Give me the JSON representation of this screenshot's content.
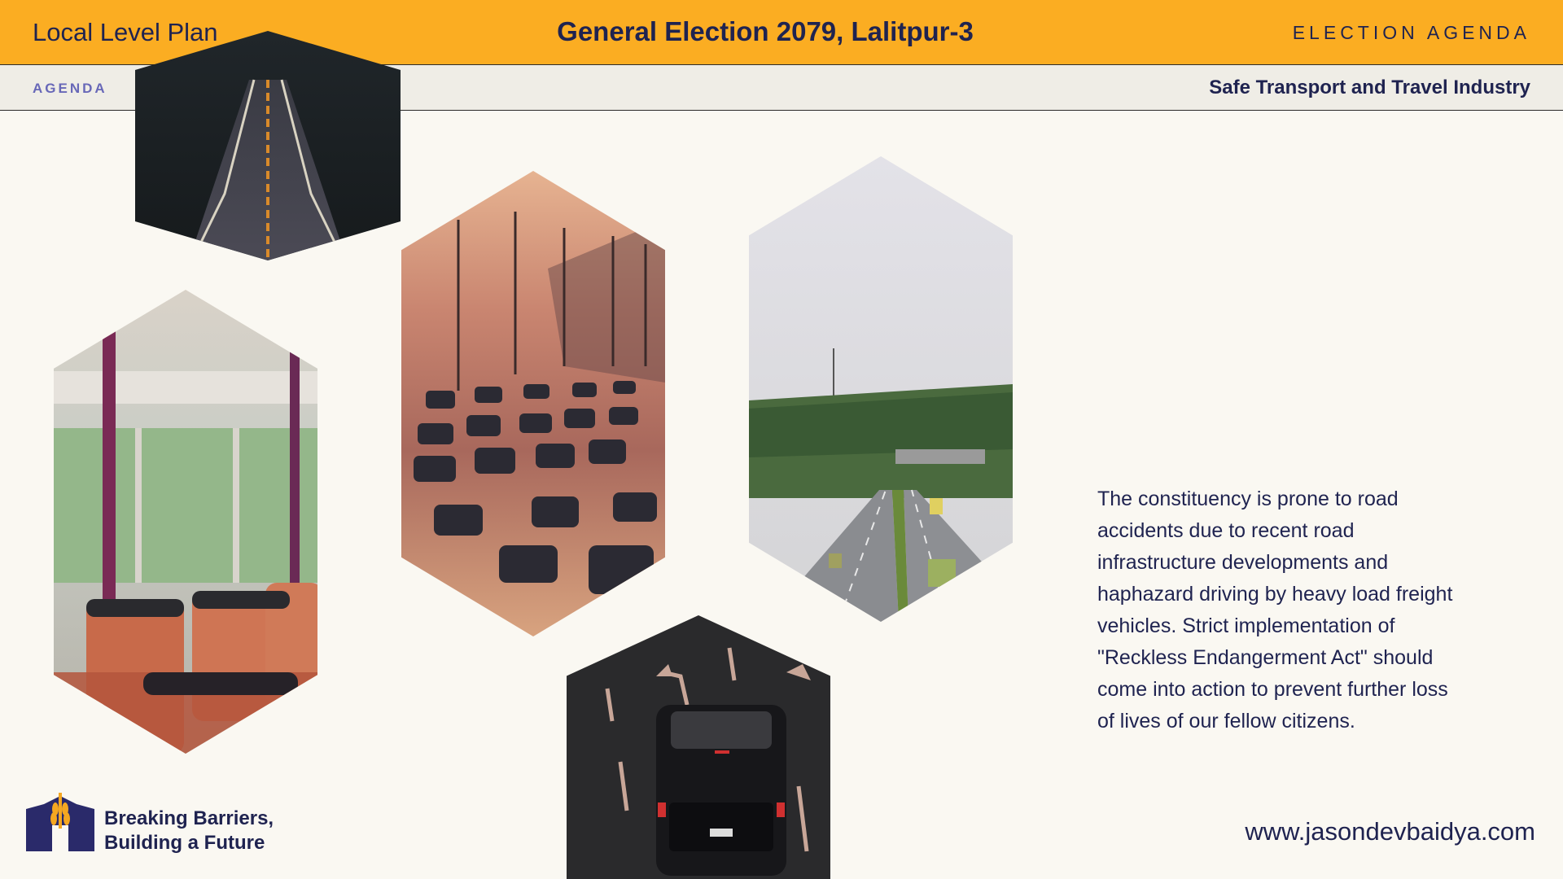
{
  "header": {
    "left_title": "Local Level Plan",
    "center_title": "General Election 2079, Lalitpur-3",
    "right_label": "ELECTION AGENDA"
  },
  "subheader": {
    "section_label": "AGENDA",
    "topic": "Safe Transport and Travel Industry"
  },
  "images": [
    {
      "name": "road-hex-image",
      "subject": "empty two-lane road at dusk"
    },
    {
      "name": "bus-interior-hex-image",
      "subject": "orange bus seats inside a bus"
    },
    {
      "name": "traffic-hex-image",
      "subject": "highway traffic at sunset"
    },
    {
      "name": "highway-hex-image",
      "subject": "divided highway with trucks"
    },
    {
      "name": "car-hex-image",
      "subject": "dark SUV on road with arrows"
    }
  ],
  "body": {
    "paragraph_lines": [
      "The constituency is prone to road",
      "accidents due to recent road",
      "infrastructure developments and",
      "haphazard driving by heavy load freight",
      "vehicles. Strict implementation of",
      "\"Reckless Endangerment Act\" should",
      "come into action to prevent further loss",
      "of lives of our fellow citizens."
    ]
  },
  "footer": {
    "tagline_line1": "Breaking Barriers,",
    "tagline_line2": "Building a Future",
    "website": "www.jasondevbaidya.com"
  },
  "colors": {
    "accent": "#fbad22",
    "navy": "#1f2350",
    "background": "#faf8f2",
    "subbar": "#efede6"
  }
}
